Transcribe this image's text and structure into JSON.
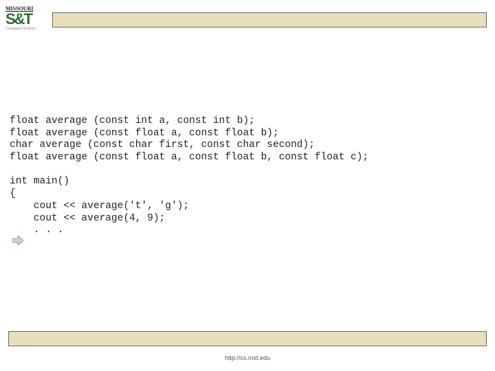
{
  "logo": {
    "line1": "MISSOURI",
    "line2": "S&T",
    "sub": "Computer Science"
  },
  "code": {
    "l1": "float average (const int a, const int b);",
    "l2": "float average (const float a, const float b);",
    "l3": "char average (const char first, const char second);",
    "l4": "float average (const float a, const float b, const float c);",
    "l5": "",
    "l6": "int main()",
    "l7": "{",
    "l8": "    cout << average('t', 'g');",
    "l9": "    cout << average(4, 9);",
    "l10": "    . . ."
  },
  "footer": "http://cs.mst.edu",
  "arrow_icon": "right-arrow"
}
